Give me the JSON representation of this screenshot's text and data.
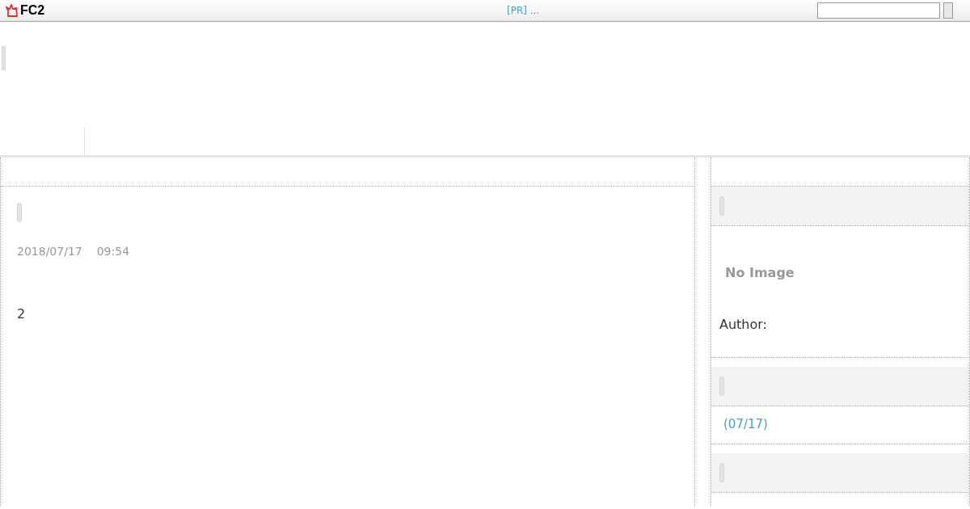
{
  "top_bar": {
    "logo": "FC2",
    "ad_link": "[PR] ..."
  },
  "entry": {
    "date": "2018/07/17",
    "time": "09:54",
    "body": "2"
  },
  "sidebar": [
    {
      "kind": "profile",
      "image_text": "No Image",
      "author_label": "Author:"
    },
    {
      "kind": "links",
      "items": [
        "(07/17)"
      ]
    },
    {
      "kind": "empty"
    }
  ]
}
